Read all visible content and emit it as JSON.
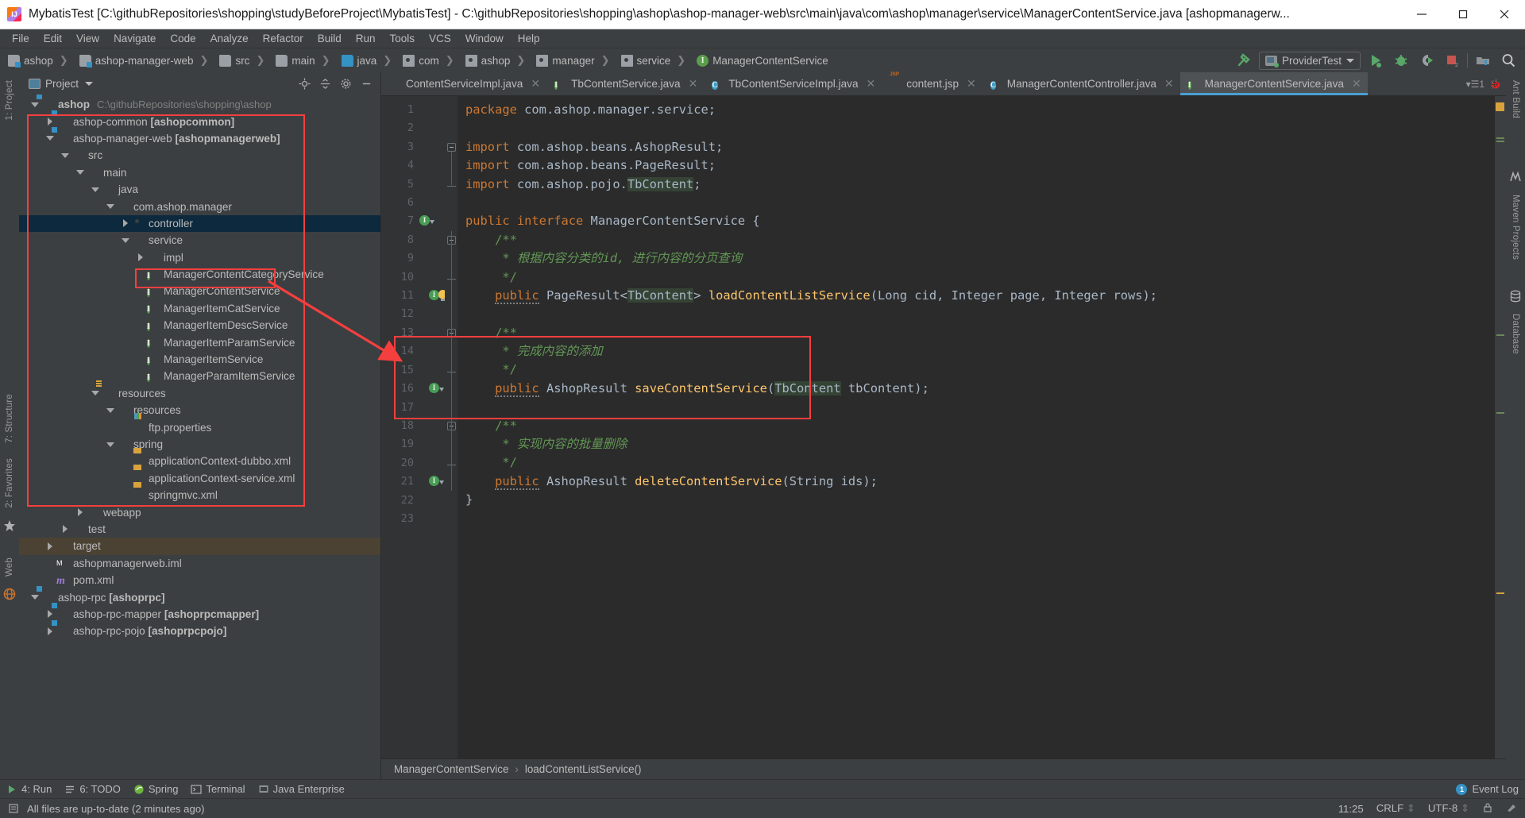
{
  "window": {
    "title": "MybatisTest [C:\\githubRepositories\\shopping\\studyBeforeProject\\MybatisTest] - C:\\githubRepositories\\shopping\\ashop\\ashop-manager-web\\src\\main\\java\\com\\ashop\\manager\\service\\ManagerContentService.java [ashopmanagerw...",
    "minimize": "minimize-button",
    "maximize": "maximize-button",
    "close": "close-button"
  },
  "menu": {
    "items": [
      "File",
      "Edit",
      "View",
      "Navigate",
      "Code",
      "Analyze",
      "Refactor",
      "Build",
      "Run",
      "Tools",
      "VCS",
      "Window",
      "Help"
    ]
  },
  "navbar": {
    "crumbs": [
      {
        "label": "ashop",
        "icon": "module-folder-icon"
      },
      {
        "label": "ashop-manager-web",
        "icon": "module-folder-icon"
      },
      {
        "label": "src",
        "icon": "folder-icon"
      },
      {
        "label": "main",
        "icon": "folder-icon"
      },
      {
        "label": "java",
        "icon": "source-folder-icon"
      },
      {
        "label": "com",
        "icon": "package-icon"
      },
      {
        "label": "ashop",
        "icon": "package-icon"
      },
      {
        "label": "manager",
        "icon": "package-icon"
      },
      {
        "label": "service",
        "icon": "package-icon"
      },
      {
        "label": "ManagerContentService",
        "icon": "interface-icon"
      }
    ],
    "run_config": "ProviderTest",
    "buttons": [
      "build-hammer-icon",
      "run-button",
      "debug-button",
      "run-with-coverage-button",
      "stop-button",
      "project-structure-button",
      "search-everywhere-button"
    ]
  },
  "project_panel": {
    "title": "Project",
    "actions": [
      "locate-icon",
      "collapse-all-icon",
      "settings-gear-icon",
      "hide-icon"
    ],
    "tree": [
      {
        "depth": 0,
        "twist": "open",
        "icon": "module-folder-icon",
        "label": "ashop",
        "bold": true,
        "path": "C:\\githubRepositories\\shopping\\ashop"
      },
      {
        "depth": 1,
        "twist": "closed",
        "icon": "module-folder-icon",
        "label": "ashop-common ",
        "bold_suffix": "[ashopcommon]"
      },
      {
        "depth": 1,
        "twist": "open",
        "icon": "module-folder-icon",
        "label": "ashop-manager-web ",
        "bold_suffix": "[ashopmanagerweb]"
      },
      {
        "depth": 2,
        "twist": "open",
        "icon": "folder-icon",
        "label": "src"
      },
      {
        "depth": 3,
        "twist": "open",
        "icon": "folder-icon",
        "label": "main"
      },
      {
        "depth": 4,
        "twist": "open",
        "icon": "source-folder-icon",
        "label": "java"
      },
      {
        "depth": 5,
        "twist": "open",
        "icon": "package-icon",
        "label": "com.ashop.manager"
      },
      {
        "depth": 6,
        "twist": "closed",
        "icon": "package-icon",
        "label": "controller",
        "selected": true
      },
      {
        "depth": 6,
        "twist": "open",
        "icon": "package-icon",
        "label": "service"
      },
      {
        "depth": 7,
        "twist": "closed",
        "icon": "package-icon",
        "label": "impl"
      },
      {
        "depth": 7,
        "twist": "none",
        "icon": "interface-icon",
        "label": "ManagerContentCategoryService"
      },
      {
        "depth": 7,
        "twist": "none",
        "icon": "interface-icon",
        "label": "ManagerContentService",
        "highlighted": true
      },
      {
        "depth": 7,
        "twist": "none",
        "icon": "interface-icon",
        "label": "ManagerItemCatService"
      },
      {
        "depth": 7,
        "twist": "none",
        "icon": "interface-icon",
        "label": "ManagerItemDescService"
      },
      {
        "depth": 7,
        "twist": "none",
        "icon": "interface-icon",
        "label": "ManagerItemParamService"
      },
      {
        "depth": 7,
        "twist": "none",
        "icon": "interface-icon",
        "label": "ManagerItemService"
      },
      {
        "depth": 7,
        "twist": "none",
        "icon": "interface-icon",
        "label": "ManagerParamItemService"
      },
      {
        "depth": 4,
        "twist": "open",
        "icon": "resources-folder-icon",
        "label": "resources"
      },
      {
        "depth": 5,
        "twist": "open",
        "icon": "package-icon",
        "label": "resources"
      },
      {
        "depth": 6,
        "twist": "none",
        "icon": "properties-file-icon",
        "label": "ftp.properties"
      },
      {
        "depth": 5,
        "twist": "open",
        "icon": "package-icon",
        "label": "spring"
      },
      {
        "depth": 6,
        "twist": "none",
        "icon": "xml-file-icon",
        "label": "applicationContext-dubbo.xml"
      },
      {
        "depth": 6,
        "twist": "none",
        "icon": "xml-file-icon",
        "label": "applicationContext-service.xml"
      },
      {
        "depth": 6,
        "twist": "none",
        "icon": "xml-file-icon",
        "label": "springmvc.xml"
      },
      {
        "depth": 3,
        "twist": "closed",
        "icon": "source-folder-icon",
        "label": "webapp"
      },
      {
        "depth": 2,
        "twist": "closed",
        "icon": "folder-icon",
        "label": "test"
      },
      {
        "depth": 1,
        "twist": "closed",
        "icon": "target-folder-icon",
        "label": "target",
        "target": true
      },
      {
        "depth": 1,
        "twist": "none",
        "icon": "iml-file-icon",
        "label": "ashopmanagerweb.iml"
      },
      {
        "depth": 1,
        "twist": "none",
        "icon": "maven-pom-icon",
        "label": "pom.xml"
      },
      {
        "depth": 0,
        "twist": "open",
        "icon": "module-folder-icon",
        "label": "ashop-rpc ",
        "bold_suffix": "[ashoprpc]"
      },
      {
        "depth": 1,
        "twist": "closed",
        "icon": "module-folder-icon",
        "label": "ashop-rpc-mapper ",
        "bold_suffix": "[ashoprpcmapper]"
      },
      {
        "depth": 1,
        "twist": "closed",
        "icon": "module-folder-icon",
        "label": "ashop-rpc-pojo ",
        "bold_suffix": "[ashoprpcpojo]"
      }
    ]
  },
  "left_rail": [
    "1: Project",
    "7: Structure",
    "2: Favorites",
    "Web"
  ],
  "right_rail": [
    "Ant Build",
    "Maven Projects",
    "Database"
  ],
  "editor_tabs": [
    {
      "label": "ContentServiceImpl.java",
      "icon": "none",
      "active": false
    },
    {
      "label": "TbContentService.java",
      "icon": "interface-icon",
      "active": false
    },
    {
      "label": "TbContentServiceImpl.java",
      "icon": "class-icon",
      "active": false
    },
    {
      "label": "content.jsp",
      "icon": "jsp-file-icon",
      "active": false
    },
    {
      "label": "ManagerContentController.java",
      "icon": "class-icon",
      "active": false
    },
    {
      "label": "ManagerContentService.java",
      "icon": "interface-icon",
      "active": true
    }
  ],
  "editor_tabstrip_right": "1",
  "code": {
    "line_count": 23,
    "lines": [
      {
        "n": 1,
        "tokens": [
          {
            "t": "package ",
            "c": "kw"
          },
          {
            "t": "com.ashop.manager.service;",
            "c": "pn"
          }
        ]
      },
      {
        "n": 2,
        "tokens": []
      },
      {
        "n": 3,
        "tokens": [
          {
            "t": "import ",
            "c": "kw"
          },
          {
            "t": "com.ashop.beans.AshopResult;",
            "c": "pn"
          }
        ]
      },
      {
        "n": 4,
        "tokens": [
          {
            "t": "import ",
            "c": "kw"
          },
          {
            "t": "com.ashop.beans.PageResult;",
            "c": "pn"
          }
        ]
      },
      {
        "n": 5,
        "tokens": [
          {
            "t": "import ",
            "c": "kw"
          },
          {
            "t": "com.ashop.pojo.",
            "c": "pn"
          },
          {
            "t": "TbContent",
            "c": "hl"
          },
          {
            "t": ";",
            "c": "pn"
          }
        ]
      },
      {
        "n": 6,
        "tokens": []
      },
      {
        "n": 7,
        "tokens": [
          {
            "t": "public ",
            "c": "kw"
          },
          {
            "t": "interface ",
            "c": "kw"
          },
          {
            "t": "ManagerContentService {",
            "c": "pn"
          }
        ]
      },
      {
        "n": 8,
        "tokens": [
          {
            "t": "    /**",
            "c": "cm2"
          }
        ]
      },
      {
        "n": 9,
        "tokens": [
          {
            "t": "     * ",
            "c": "cm2"
          },
          {
            "t": "根据内容分类的id, 进行内容的分页查询",
            "c": "cm"
          }
        ]
      },
      {
        "n": 10,
        "tokens": [
          {
            "t": "     */",
            "c": "cm2"
          }
        ]
      },
      {
        "n": 11,
        "tokens": [
          {
            "t": "    ",
            "c": "pn"
          },
          {
            "t": "public",
            "c": "kw-sq"
          },
          {
            "t": " PageResult<",
            "c": "pn"
          },
          {
            "t": "TbContent",
            "c": "hl"
          },
          {
            "t": "> ",
            "c": "pn"
          },
          {
            "t": "loadContentListService",
            "c": "mth"
          },
          {
            "t": "(Long cid, Integer page, Integer rows);",
            "c": "pn"
          }
        ]
      },
      {
        "n": 12,
        "tokens": []
      },
      {
        "n": 13,
        "tokens": [
          {
            "t": "    /**",
            "c": "cm2"
          }
        ]
      },
      {
        "n": 14,
        "tokens": [
          {
            "t": "     * ",
            "c": "cm2"
          },
          {
            "t": "完成内容的添加",
            "c": "cm"
          }
        ]
      },
      {
        "n": 15,
        "tokens": [
          {
            "t": "     */",
            "c": "cm2"
          }
        ]
      },
      {
        "n": 16,
        "tokens": [
          {
            "t": "    ",
            "c": "pn"
          },
          {
            "t": "public",
            "c": "kw-sq"
          },
          {
            "t": " AshopResult ",
            "c": "pn"
          },
          {
            "t": "saveContentService",
            "c": "mth"
          },
          {
            "t": "(",
            "c": "pn"
          },
          {
            "t": "TbContent",
            "c": "hl"
          },
          {
            "t": " tbContent);",
            "c": "pn"
          }
        ]
      },
      {
        "n": 17,
        "tokens": []
      },
      {
        "n": 18,
        "tokens": [
          {
            "t": "    /**",
            "c": "cm2"
          }
        ]
      },
      {
        "n": 19,
        "tokens": [
          {
            "t": "     * ",
            "c": "cm2"
          },
          {
            "t": "实现内容的批量删除",
            "c": "cm"
          }
        ]
      },
      {
        "n": 20,
        "tokens": [
          {
            "t": "     */",
            "c": "cm2"
          }
        ]
      },
      {
        "n": 21,
        "tokens": [
          {
            "t": "    ",
            "c": "pn"
          },
          {
            "t": "public",
            "c": "kw-sq"
          },
          {
            "t": " AshopResult ",
            "c": "pn"
          },
          {
            "t": "deleteContentService",
            "c": "mth"
          },
          {
            "t": "(String ids);",
            "c": "pn"
          }
        ]
      },
      {
        "n": 22,
        "tokens": [
          {
            "t": "}",
            "c": "pn"
          }
        ]
      },
      {
        "n": 23,
        "tokens": []
      }
    ]
  },
  "editor_breadcrumb": {
    "class": "ManagerContentService",
    "separator": "›",
    "member": "loadContentListService()"
  },
  "bottom_bar": {
    "items": [
      {
        "label": "4: Run",
        "icon": "run-icon"
      },
      {
        "label": "6: TODO",
        "icon": "todo-icon"
      },
      {
        "label": "Spring",
        "icon": "spring-icon"
      },
      {
        "label": "Terminal",
        "icon": "terminal-icon"
      },
      {
        "label": "Java Enterprise",
        "icon": "java-ee-icon"
      }
    ],
    "event_log": "Event Log",
    "event_count": "1"
  },
  "status_bar": {
    "message": "All files are up-to-date (2 minutes ago)",
    "time": "11:25",
    "line_sep": "CRLF",
    "encoding": "UTF-8",
    "lock": "write-access-icon",
    "inspection": "inspection-icon"
  },
  "annotations": {
    "color": "#f43f3f",
    "boxes": [
      "project-subtree-highlight",
      "manager-content-service-highlight",
      "delete-method-highlight"
    ],
    "arrow": "pointer-arrow"
  }
}
